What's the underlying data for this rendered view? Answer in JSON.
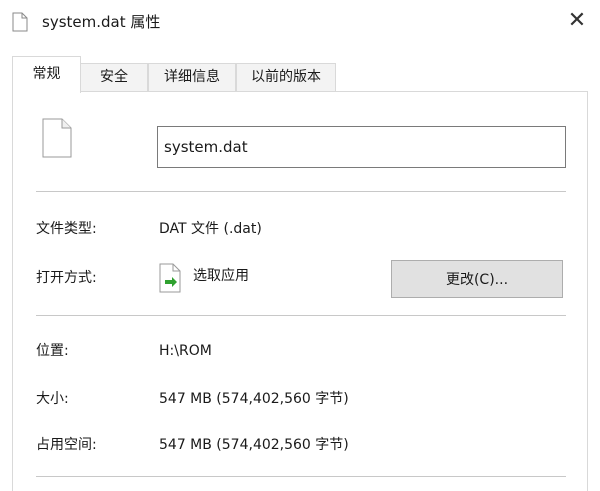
{
  "window": {
    "title": "system.dat 属性",
    "close_symbol": "✕"
  },
  "tabs": [
    {
      "label": "常规",
      "active": true
    },
    {
      "label": "安全",
      "active": false
    },
    {
      "label": "详细信息",
      "active": false
    },
    {
      "label": "以前的版本",
      "active": false
    }
  ],
  "general": {
    "file_name": "system.dat",
    "file_type_label": "文件类型:",
    "file_type_value": "DAT 文件 (.dat)",
    "open_with_label": "打开方式:",
    "open_with_value": "选取应用",
    "change_button": "更改(C)...",
    "location_label": "位置:",
    "location_value": "H:\\ROM",
    "size_label": "大小:",
    "size_value": "547 MB (574,402,560 字节)",
    "size_on_disk_label": "占用空间:",
    "size_on_disk_value": "547 MB (574,402,560 字节)"
  },
  "icons": {
    "title": "document-icon",
    "file": "blank-file-icon",
    "open_with": "choose-app-icon"
  }
}
